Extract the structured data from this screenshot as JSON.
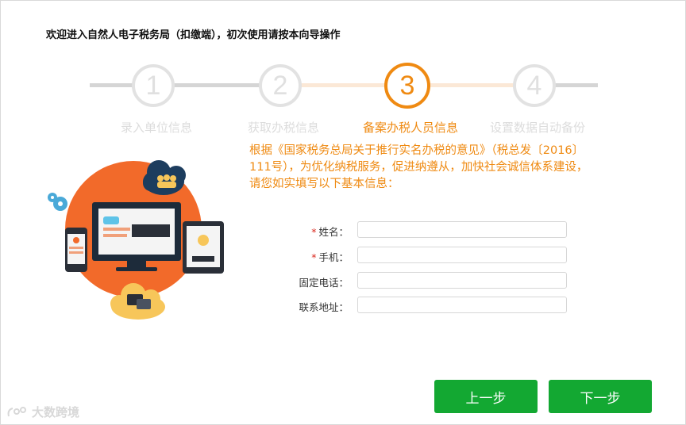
{
  "window": {
    "title": "欢迎进入自然人电子税务局（扣缴端），初次使用请按本向导操作"
  },
  "steps": [
    {
      "number": "1",
      "label": "录入单位信息",
      "state": "done"
    },
    {
      "number": "2",
      "label": "获取办税信息",
      "state": "done"
    },
    {
      "number": "3",
      "label": "备案办税人员信息",
      "state": "active"
    },
    {
      "number": "4",
      "label": "设置数据自动备份",
      "state": "pending"
    }
  ],
  "intro": "根据《国家税务总局关于推行实名办税的意见》（税总发〔2016〕111号），为优化纳税服务，促进纳遵从，加快社会诚信体系建设，请您如实填写以下基本信息：",
  "form": {
    "name": {
      "required_mark": "*",
      "label": "姓名：",
      "value": ""
    },
    "mobile": {
      "required_mark": "*",
      "label": "手机：",
      "value": ""
    },
    "phone": {
      "label": "固定电话：",
      "value": ""
    },
    "address": {
      "label": "联系地址：",
      "value": ""
    }
  },
  "buttons": {
    "prev": "上一步",
    "next": "下一步"
  },
  "watermark": {
    "text": "大数跨境"
  },
  "colors": {
    "accent": "#ef8a12",
    "button": "#13a832",
    "inactive": "#e2e2e2",
    "illustration_orange": "#f26a2a",
    "cloud_navy": "#1d3d5e",
    "cloud_yellow": "#f7c65a"
  }
}
